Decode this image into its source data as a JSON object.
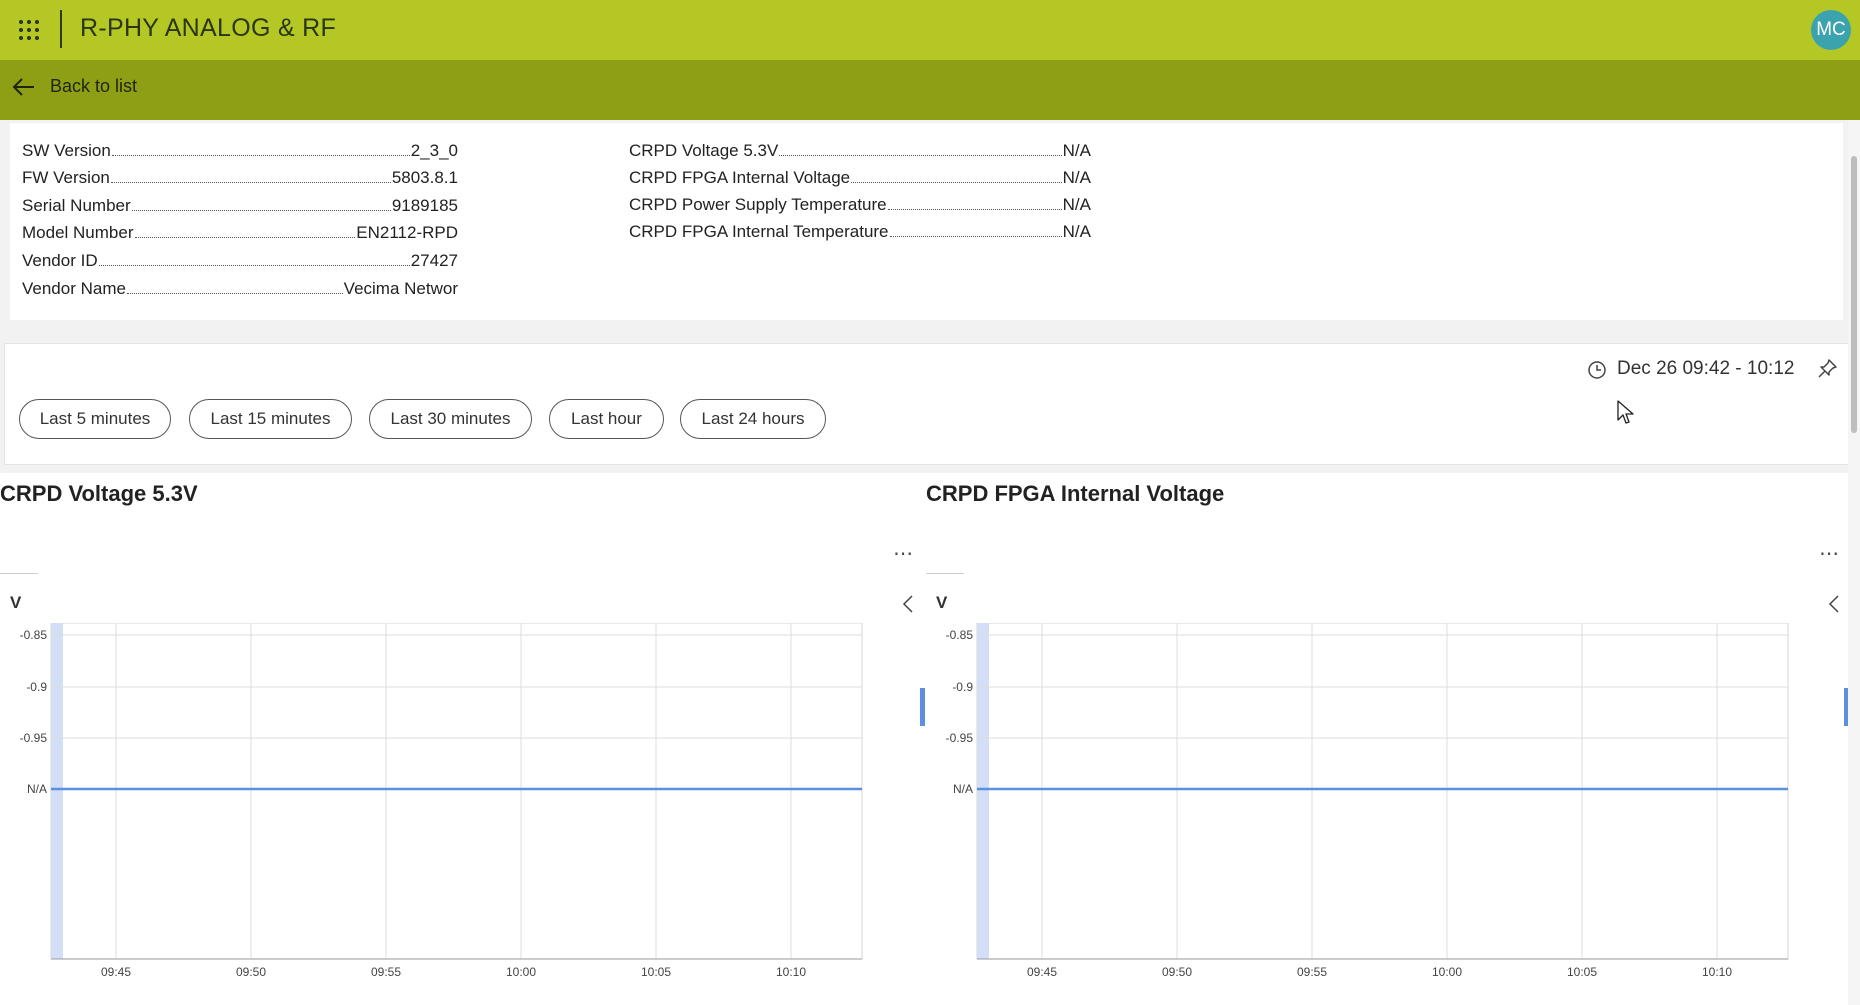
{
  "header": {
    "app_title": "R-PHY ANALOG & RF",
    "avatar_initials": "MC",
    "apps_icon": "waffle-grid-icon",
    "bar_color": "#b5c725"
  },
  "subheader": {
    "back_label": "Back to list",
    "back_icon": "arrow-left-icon",
    "bar_color": "#8e9f16"
  },
  "info": {
    "left": [
      {
        "label": "SW Version",
        "value": "2_3_0"
      },
      {
        "label": "FW Version",
        "value": "5803.8.1"
      },
      {
        "label": "Serial Number",
        "value": "9189185"
      },
      {
        "label": "Model Number",
        "value": "EN2112-RPD"
      },
      {
        "label": "Vendor ID",
        "value": "27427"
      },
      {
        "label": "Vendor Name",
        "value": "Vecima Networ"
      }
    ],
    "right": [
      {
        "label": "CRPD Voltage 5.3V",
        "value": "N/A"
      },
      {
        "label": "CRPD FPGA Internal Voltage",
        "value": "N/A"
      },
      {
        "label": "CRPD Power Supply Temperature",
        "value": "N/A"
      },
      {
        "label": "CRPD FPGA Internal Temperature",
        "value": "N/A"
      }
    ]
  },
  "time_filter": {
    "buttons": [
      "Last 5 minutes",
      "Last 15 minutes",
      "Last 30 minutes",
      "Last hour",
      "Last 24 hours"
    ],
    "range_label": "Dec 26 09:42 - 10:12",
    "clock_icon": "clock-icon",
    "pin_icon": "pin-icon"
  },
  "charts": [
    {
      "title": "CRPD Voltage 5.3V",
      "unit": "V"
    },
    {
      "title": "CRPD FPGA Internal Voltage",
      "unit": "V"
    }
  ],
  "chart_data": [
    {
      "type": "line",
      "title": "CRPD Voltage 5.3V",
      "ylabel": "V",
      "y_tick_labels": [
        "-0.85",
        "-0.9",
        "-0.95",
        "N/A"
      ],
      "x_tick_labels": [
        "09:45",
        "09:50",
        "09:55",
        "10:00",
        "10:05",
        "10:10"
      ],
      "series": [
        {
          "values": [
            "N/A",
            "N/A"
          ]
        }
      ],
      "grid": true,
      "line_color": "#5b8fe0"
    },
    {
      "type": "line",
      "title": "CRPD FPGA Internal Voltage",
      "ylabel": "V",
      "y_tick_labels": [
        "-0.85",
        "-0.9",
        "-0.95",
        "N/A"
      ],
      "x_tick_labels": [
        "09:45",
        "09:50",
        "09:55",
        "10:00",
        "10:05",
        "10:10"
      ],
      "series": [
        {
          "values": [
            "N/A",
            "N/A"
          ]
        }
      ],
      "grid": true,
      "line_color": "#5b8fe0"
    }
  ]
}
